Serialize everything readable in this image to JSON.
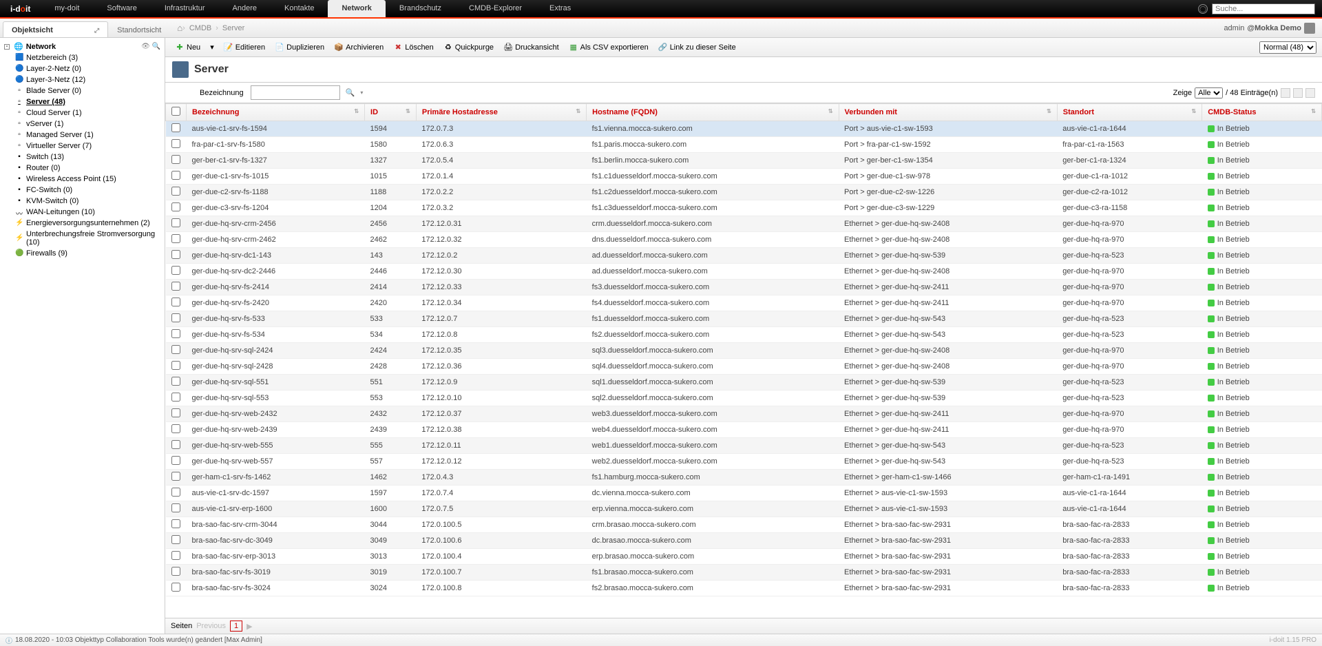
{
  "top": {
    "logo_prefix": "i-d",
    "logo_o": "o",
    "logo_suffix": "it",
    "nav": [
      "my-doit",
      "Software",
      "Infrastruktur",
      "Andere",
      "Kontakte",
      "Network",
      "Brandschutz",
      "CMDB-Explorer",
      "Extras"
    ],
    "nav_active": "Network",
    "search_placeholder": "Suche..."
  },
  "subtabs": {
    "items": [
      "Objektsicht",
      "Standortsicht"
    ],
    "active": "Objektsicht"
  },
  "breadcrumb": [
    "CMDB",
    "Server"
  ],
  "user": {
    "name": "admin",
    "tenant": "@Mokka Demo"
  },
  "toolbar": {
    "neu": "Neu",
    "editieren": "Editieren",
    "duplizieren": "Duplizieren",
    "archivieren": "Archivieren",
    "loeschen": "Löschen",
    "quickpurge": "Quickpurge",
    "druck": "Druckansicht",
    "csv": "Als CSV exportieren",
    "link": "Link zu dieser Seite",
    "normal": "Normal (48)"
  },
  "pageTitle": "Server",
  "filter": {
    "label": "Bezeichnung",
    "zeige": "Zeige",
    "alle": "Alle",
    "eintraege": "/ 48 Einträge(n)"
  },
  "tree": {
    "root": "Network",
    "items": [
      {
        "label": "Netzbereich (3)",
        "icon": "🟦"
      },
      {
        "label": "Layer-2-Netz (0)",
        "icon": "🔵"
      },
      {
        "label": "Layer-3-Netz (12)",
        "icon": "🔵"
      },
      {
        "label": "Blade Server (0)",
        "icon": "▫"
      },
      {
        "label": "Server (48)",
        "icon": "▫",
        "sel": true
      },
      {
        "label": "Cloud Server (1)",
        "icon": "▫"
      },
      {
        "label": "vServer (1)",
        "icon": "▫"
      },
      {
        "label": "Managed Server (1)",
        "icon": "▫"
      },
      {
        "label": "Virtueller Server (7)",
        "icon": "▫"
      },
      {
        "label": "Switch (13)",
        "icon": "▪"
      },
      {
        "label": "Router (0)",
        "icon": "▪"
      },
      {
        "label": "Wireless Access Point (15)",
        "icon": "▪"
      },
      {
        "label": "FC-Switch (0)",
        "icon": "▪"
      },
      {
        "label": "KVM-Switch (0)",
        "icon": "▪"
      },
      {
        "label": "WAN-Leitungen (10)",
        "icon": "〰"
      },
      {
        "label": "Energieversorgungsunternehmen (2)",
        "icon": "⚡"
      },
      {
        "label": "Unterbrechungsfreie Stromversorgung (10)",
        "icon": "⚡"
      },
      {
        "label": "Firewalls (9)",
        "icon": "🟢"
      }
    ]
  },
  "columns": [
    "Bezeichnung",
    "ID",
    "Primäre Hostadresse",
    "Hostname (FQDN)",
    "Verbunden mit",
    "Standort",
    "CMDB-Status"
  ],
  "rows": [
    {
      "b": "aus-vie-c1-srv-fs-1594",
      "id": "1594",
      "ip": "172.0.7.3",
      "h": "fs1.vienna.mocca-sukero.com",
      "v": "Port > aus-vie-c1-sw-1593",
      "s": "aus-vie-c1-ra-1644",
      "st": "In Betrieb",
      "sel": true
    },
    {
      "b": "fra-par-c1-srv-fs-1580",
      "id": "1580",
      "ip": "172.0.6.3",
      "h": "fs1.paris.mocca-sukero.com",
      "v": "Port > fra-par-c1-sw-1592",
      "s": "fra-par-c1-ra-1563",
      "st": "In Betrieb"
    },
    {
      "b": "ger-ber-c1-srv-fs-1327",
      "id": "1327",
      "ip": "172.0.5.4",
      "h": "fs1.berlin.mocca-sukero.com",
      "v": "Port > ger-ber-c1-sw-1354",
      "s": "ger-ber-c1-ra-1324",
      "st": "In Betrieb"
    },
    {
      "b": "ger-due-c1-srv-fs-1015",
      "id": "1015",
      "ip": "172.0.1.4",
      "h": "fs1.c1duesseldorf.mocca-sukero.com",
      "v": "Port > ger-due-c1-sw-978",
      "s": "ger-due-c1-ra-1012",
      "st": "In Betrieb"
    },
    {
      "b": "ger-due-c2-srv-fs-1188",
      "id": "1188",
      "ip": "172.0.2.2",
      "h": "fs1.c2duesseldorf.mocca-sukero.com",
      "v": "Port > ger-due-c2-sw-1226",
      "s": "ger-due-c2-ra-1012",
      "st": "In Betrieb"
    },
    {
      "b": "ger-due-c3-srv-fs-1204",
      "id": "1204",
      "ip": "172.0.3.2",
      "h": "fs1.c3duesseldorf.mocca-sukero.com",
      "v": "Port > ger-due-c3-sw-1229",
      "s": "ger-due-c3-ra-1158",
      "st": "In Betrieb"
    },
    {
      "b": "ger-due-hq-srv-crm-2456",
      "id": "2456",
      "ip": "172.12.0.31",
      "h": "crm.duesseldorf.mocca-sukero.com",
      "v": "Ethernet > ger-due-hq-sw-2408",
      "s": "ger-due-hq-ra-970",
      "st": "In Betrieb"
    },
    {
      "b": "ger-due-hq-srv-crm-2462",
      "id": "2462",
      "ip": "172.12.0.32",
      "h": "dns.duesseldorf.mocca-sukero.com",
      "v": "Ethernet > ger-due-hq-sw-2408",
      "s": "ger-due-hq-ra-970",
      "st": "In Betrieb"
    },
    {
      "b": "ger-due-hq-srv-dc1-143",
      "id": "143",
      "ip": "172.12.0.2",
      "h": "ad.duesseldorf.mocca-sukero.com",
      "v": "Ethernet > ger-due-hq-sw-539",
      "s": "ger-due-hq-ra-523",
      "st": "In Betrieb"
    },
    {
      "b": "ger-due-hq-srv-dc2-2446",
      "id": "2446",
      "ip": "172.12.0.30",
      "h": "ad.duesseldorf.mocca-sukero.com",
      "v": "Ethernet > ger-due-hq-sw-2408",
      "s": "ger-due-hq-ra-970",
      "st": "In Betrieb"
    },
    {
      "b": "ger-due-hq-srv-fs-2414",
      "id": "2414",
      "ip": "172.12.0.33",
      "h": "fs3.duesseldorf.mocca-sukero.com",
      "v": "Ethernet > ger-due-hq-sw-2411",
      "s": "ger-due-hq-ra-970",
      "st": "In Betrieb"
    },
    {
      "b": "ger-due-hq-srv-fs-2420",
      "id": "2420",
      "ip": "172.12.0.34",
      "h": "fs4.duesseldorf.mocca-sukero.com",
      "v": "Ethernet > ger-due-hq-sw-2411",
      "s": "ger-due-hq-ra-970",
      "st": "In Betrieb"
    },
    {
      "b": "ger-due-hq-srv-fs-533",
      "id": "533",
      "ip": "172.12.0.7",
      "h": "fs1.duesseldorf.mocca-sukero.com",
      "v": "Ethernet > ger-due-hq-sw-543",
      "s": "ger-due-hq-ra-523",
      "st": "In Betrieb"
    },
    {
      "b": "ger-due-hq-srv-fs-534",
      "id": "534",
      "ip": "172.12.0.8",
      "h": "fs2.duesseldorf.mocca-sukero.com",
      "v": "Ethernet > ger-due-hq-sw-543",
      "s": "ger-due-hq-ra-523",
      "st": "In Betrieb"
    },
    {
      "b": "ger-due-hq-srv-sql-2424",
      "id": "2424",
      "ip": "172.12.0.35",
      "h": "sql3.duesseldorf.mocca-sukero.com",
      "v": "Ethernet > ger-due-hq-sw-2408",
      "s": "ger-due-hq-ra-970",
      "st": "In Betrieb"
    },
    {
      "b": "ger-due-hq-srv-sql-2428",
      "id": "2428",
      "ip": "172.12.0.36",
      "h": "sql4.duesseldorf.mocca-sukero.com",
      "v": "Ethernet > ger-due-hq-sw-2408",
      "s": "ger-due-hq-ra-970",
      "st": "In Betrieb"
    },
    {
      "b": "ger-due-hq-srv-sql-551",
      "id": "551",
      "ip": "172.12.0.9",
      "h": "sql1.duesseldorf.mocca-sukero.com",
      "v": "Ethernet > ger-due-hq-sw-539",
      "s": "ger-due-hq-ra-523",
      "st": "In Betrieb"
    },
    {
      "b": "ger-due-hq-srv-sql-553",
      "id": "553",
      "ip": "172.12.0.10",
      "h": "sql2.duesseldorf.mocca-sukero.com",
      "v": "Ethernet > ger-due-hq-sw-539",
      "s": "ger-due-hq-ra-523",
      "st": "In Betrieb"
    },
    {
      "b": "ger-due-hq-srv-web-2432",
      "id": "2432",
      "ip": "172.12.0.37",
      "h": "web3.duesseldorf.mocca-sukero.com",
      "v": "Ethernet > ger-due-hq-sw-2411",
      "s": "ger-due-hq-ra-970",
      "st": "In Betrieb"
    },
    {
      "b": "ger-due-hq-srv-web-2439",
      "id": "2439",
      "ip": "172.12.0.38",
      "h": "web4.duesseldorf.mocca-sukero.com",
      "v": "Ethernet > ger-due-hq-sw-2411",
      "s": "ger-due-hq-ra-970",
      "st": "In Betrieb"
    },
    {
      "b": "ger-due-hq-srv-web-555",
      "id": "555",
      "ip": "172.12.0.11",
      "h": "web1.duesseldorf.mocca-sukero.com",
      "v": "Ethernet > ger-due-hq-sw-543",
      "s": "ger-due-hq-ra-523",
      "st": "In Betrieb"
    },
    {
      "b": "ger-due-hq-srv-web-557",
      "id": "557",
      "ip": "172.12.0.12",
      "h": "web2.duesseldorf.mocca-sukero.com",
      "v": "Ethernet > ger-due-hq-sw-543",
      "s": "ger-due-hq-ra-523",
      "st": "In Betrieb"
    },
    {
      "b": "ger-ham-c1-srv-fs-1462",
      "id": "1462",
      "ip": "172.0.4.3",
      "h": "fs1.hamburg.mocca-sukero.com",
      "v": "Ethernet > ger-ham-c1-sw-1466",
      "s": "ger-ham-c1-ra-1491",
      "st": "In Betrieb"
    },
    {
      "b": "aus-vie-c1-srv-dc-1597",
      "id": "1597",
      "ip": "172.0.7.4",
      "h": "dc.vienna.mocca-sukero.com",
      "v": "Ethernet > aus-vie-c1-sw-1593",
      "s": "aus-vie-c1-ra-1644",
      "st": "In Betrieb"
    },
    {
      "b": "aus-vie-c1-srv-erp-1600",
      "id": "1600",
      "ip": "172.0.7.5",
      "h": "erp.vienna.mocca-sukero.com",
      "v": "Ethernet > aus-vie-c1-sw-1593",
      "s": "aus-vie-c1-ra-1644",
      "st": "In Betrieb"
    },
    {
      "b": "bra-sao-fac-srv-crm-3044",
      "id": "3044",
      "ip": "172.0.100.5",
      "h": "crm.brasao.mocca-sukero.com",
      "v": "Ethernet > bra-sao-fac-sw-2931",
      "s": "bra-sao-fac-ra-2833",
      "st": "In Betrieb"
    },
    {
      "b": "bra-sao-fac-srv-dc-3049",
      "id": "3049",
      "ip": "172.0.100.6",
      "h": "dc.brasao.mocca-sukero.com",
      "v": "Ethernet > bra-sao-fac-sw-2931",
      "s": "bra-sao-fac-ra-2833",
      "st": "In Betrieb"
    },
    {
      "b": "bra-sao-fac-srv-erp-3013",
      "id": "3013",
      "ip": "172.0.100.4",
      "h": "erp.brasao.mocca-sukero.com",
      "v": "Ethernet > bra-sao-fac-sw-2931",
      "s": "bra-sao-fac-ra-2833",
      "st": "In Betrieb"
    },
    {
      "b": "bra-sao-fac-srv-fs-3019",
      "id": "3019",
      "ip": "172.0.100.7",
      "h": "fs1.brasao.mocca-sukero.com",
      "v": "Ethernet > bra-sao-fac-sw-2931",
      "s": "bra-sao-fac-ra-2833",
      "st": "In Betrieb"
    },
    {
      "b": "bra-sao-fac-srv-fs-3024",
      "id": "3024",
      "ip": "172.0.100.8",
      "h": "fs2.brasao.mocca-sukero.com",
      "v": "Ethernet > bra-sao-fac-sw-2931",
      "s": "bra-sao-fac-ra-2833",
      "st": "In Betrieb"
    }
  ],
  "pagination": {
    "seiten": "Seiten",
    "previous": "Previous",
    "page": "1"
  },
  "status": {
    "msg": "18.08.2020 - 10:03 Objekttyp Collaboration Tools wurde(n) geändert [Max Admin]",
    "ver": "i-doit 1.15 PRO"
  }
}
